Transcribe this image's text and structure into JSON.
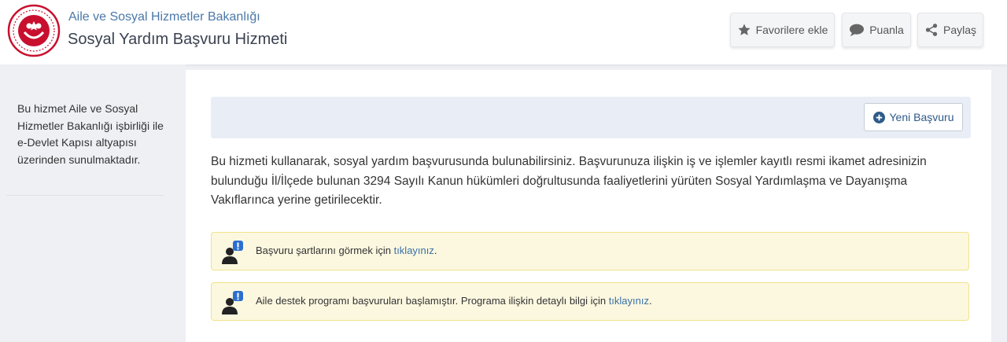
{
  "header": {
    "ministry": "Aile ve Sosyal Hizmetler Bakanlığı",
    "service_title": "Sosyal Yardım Başvuru Hizmeti",
    "buttons": {
      "favorite": "Favorilere ekle",
      "rate": "Puanla",
      "share": "Paylaş"
    },
    "icons": {
      "favorite": "star-icon",
      "rate": "speech-bubble-icon",
      "share": "share-icon"
    }
  },
  "sidebar": {
    "info_text": "Bu hizmet Aile ve Sosyal Hizmetler Bakanlığı işbirliği ile e-Devlet Kapısı altyapısı üzerinden sunulmaktadır."
  },
  "main": {
    "new_application_button": "Yeni Başvuru",
    "description": "Bu hizmeti kullanarak, sosyal yardım başvurusunda bulunabilirsiniz. Başvurunuza ilişkin iş ve işlemler kayıtlı resmi ikamet adresinizin bulunduğu İl/İlçede bulunan 3294 Sayılı Kanun hükümleri doğrultusunda faaliyetlerini yürüten Sosyal Yardımlaşma ve Dayanışma Vakıflarınca yerine getirilecektir.",
    "alerts": [
      {
        "text": "Başvuru şartlarını görmek için ",
        "link": "tıklayınız",
        "suffix": "."
      },
      {
        "text": "Aile destek programı başvuruları başlamıştır. Programa ilişkin detaylı bilgi için ",
        "link": "tıklayınız",
        "suffix": "."
      }
    ]
  },
  "colors": {
    "brand_red": "#c8102e",
    "link_blue": "#3a6fa6",
    "alert_bg": "#fcf8e0",
    "alert_border": "#f2e28a",
    "toolbar_bg": "#e9eef6"
  }
}
